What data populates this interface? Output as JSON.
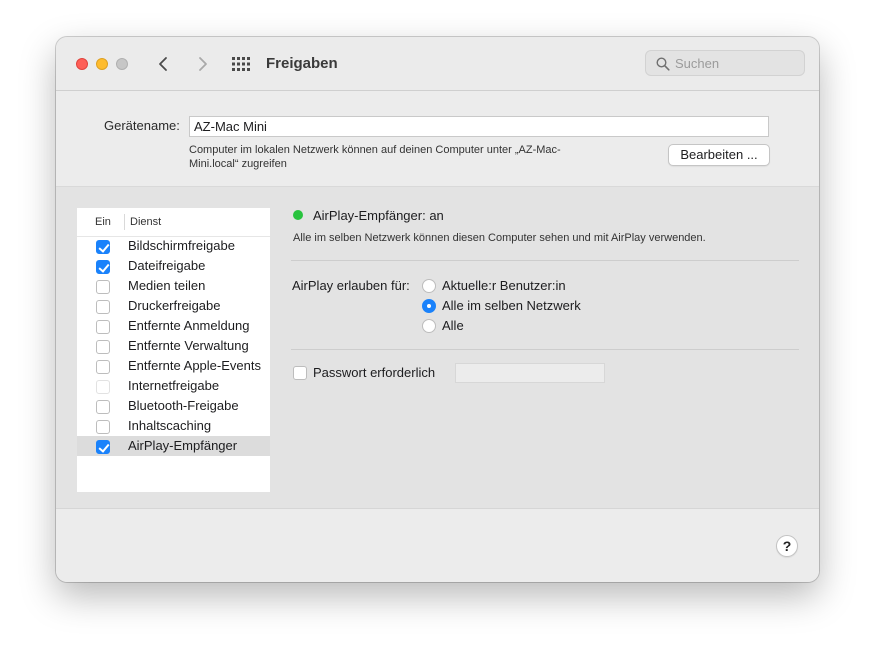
{
  "window": {
    "title": "Freigaben",
    "search_placeholder": "Suchen"
  },
  "device": {
    "label": "Gerätename:",
    "value": "AZ-Mac Mini",
    "note_line1": "Computer im lokalen Netzwerk können auf deinen Computer unter „AZ-Mac-",
    "note_line2": "Mini.local“ zugreifen",
    "edit_button": "Bearbeiten ..."
  },
  "services": {
    "header_on": "Ein",
    "header_service": "Dienst",
    "items": [
      {
        "label": "Bildschirmfreigabe",
        "checked": true
      },
      {
        "label": "Dateifreigabe",
        "checked": true
      },
      {
        "label": "Medien teilen",
        "checked": false
      },
      {
        "label": "Druckerfreigabe",
        "checked": false
      },
      {
        "label": "Entfernte Anmeldung",
        "checked": false
      },
      {
        "label": "Entfernte Verwaltung",
        "checked": false
      },
      {
        "label": "Entfernte Apple-Events",
        "checked": false
      },
      {
        "label": "Internetfreigabe",
        "checked": false,
        "disabled": true
      },
      {
        "label": "Bluetooth-Freigabe",
        "checked": false
      },
      {
        "label": "Inhaltscaching",
        "checked": false
      },
      {
        "label": "AirPlay-Empfänger",
        "checked": true,
        "selected": true
      }
    ]
  },
  "detail": {
    "status": "AirPlay-Empfänger: an",
    "status_color": "#29c33e",
    "description": "Alle im selben Netzwerk können diesen Computer sehen und mit AirPlay verwenden.",
    "allow_label": "AirPlay erlauben für:",
    "options": [
      {
        "label": "Aktuelle:r Benutzer:in",
        "selected": false
      },
      {
        "label": "Alle im selben Netzwerk",
        "selected": true
      },
      {
        "label": "Alle",
        "selected": false
      }
    ],
    "password_label": "Passwort erforderlich",
    "password_checked": false,
    "password_value": ""
  },
  "help_label": "?",
  "accent_color": "#1a82fb"
}
